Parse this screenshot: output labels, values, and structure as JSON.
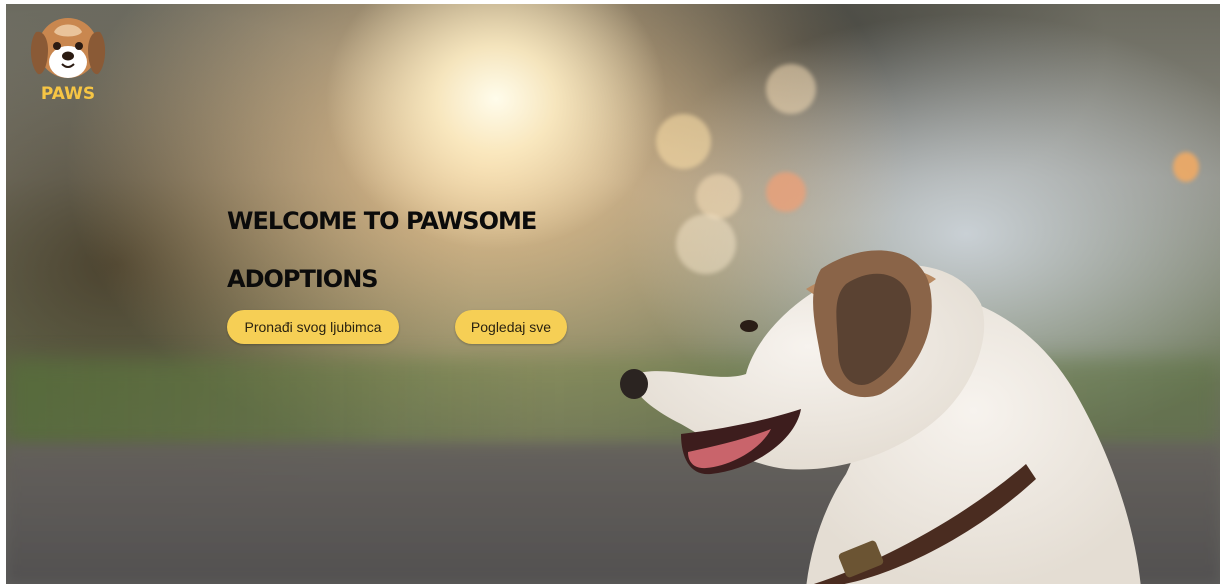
{
  "brand": {
    "name": "PAWS",
    "logo_icon": "dog-face-icon",
    "accent_color": "#f6cf55"
  },
  "hero": {
    "headline": "WELCOME TO PAWSOME ADOPTIONS",
    "image": "dog-photo"
  },
  "buttons": {
    "find_pet_label": "Pronađi svog ljubimca",
    "view_all_label": "Pogledaj sve"
  }
}
